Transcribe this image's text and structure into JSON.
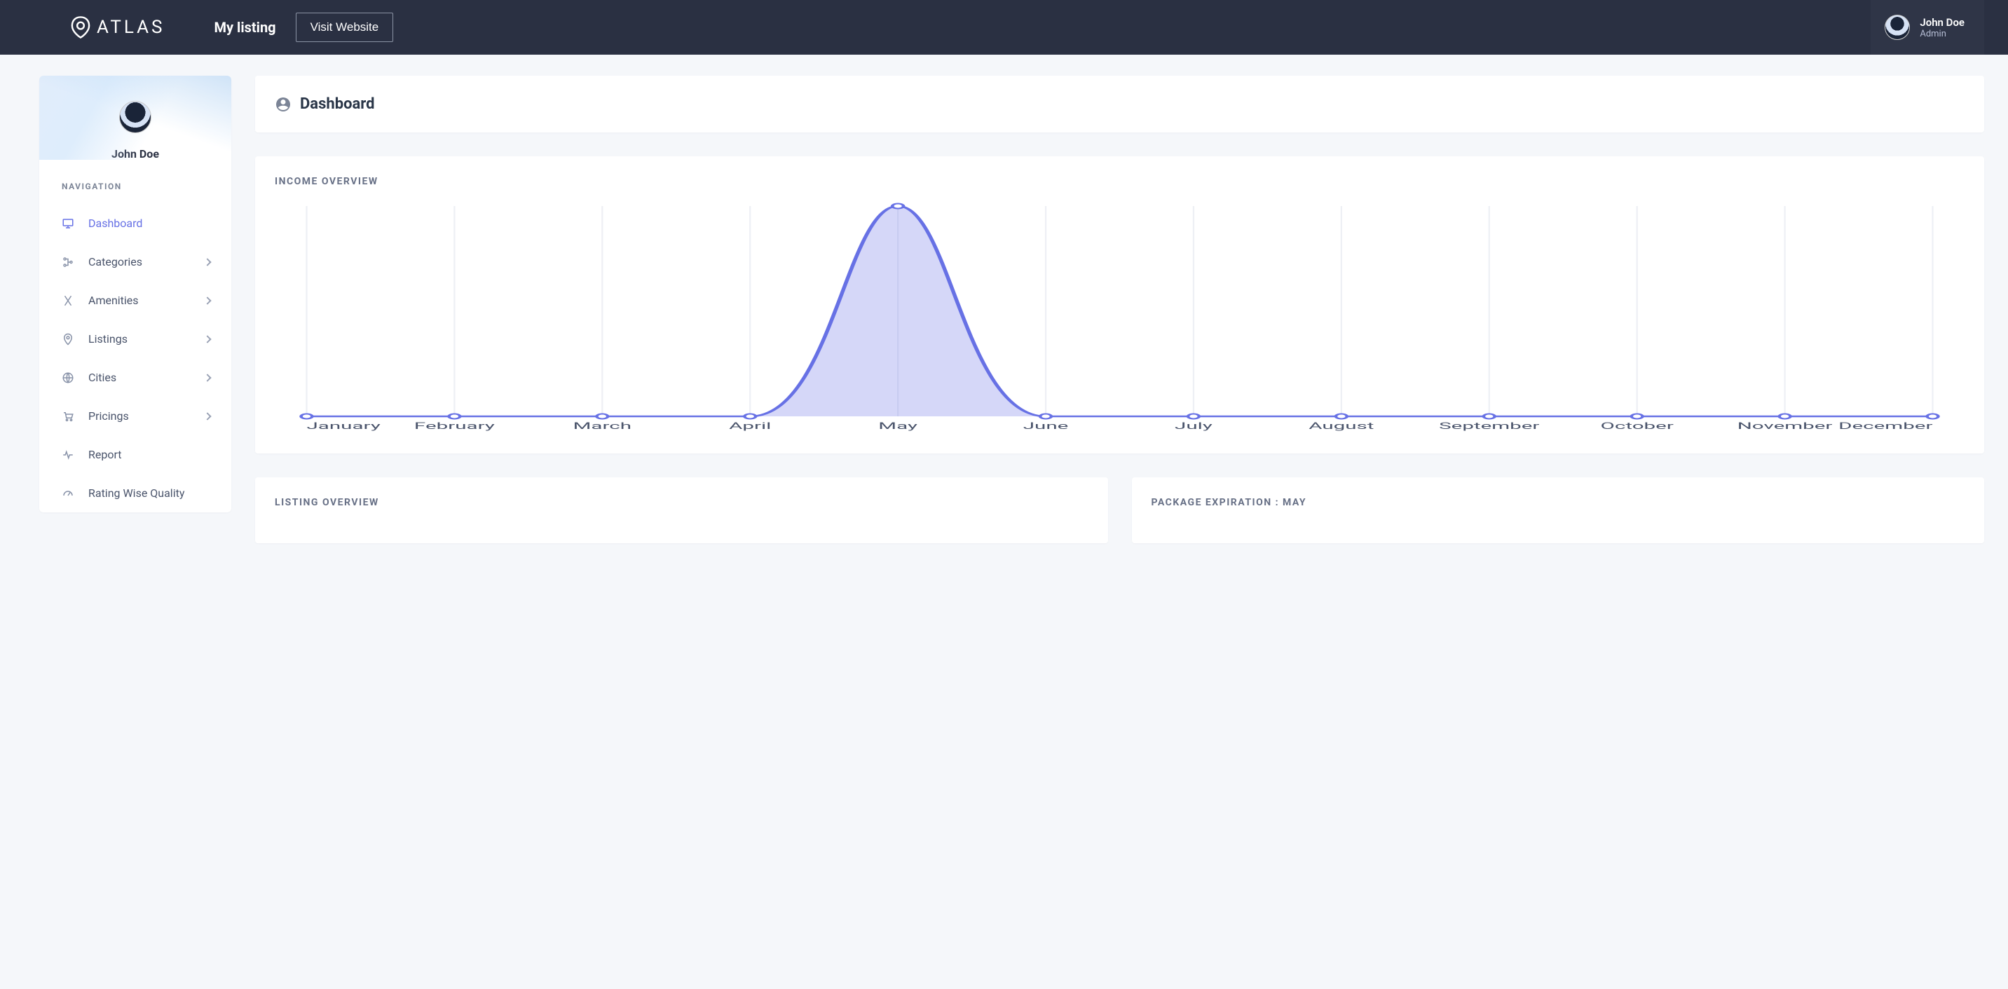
{
  "header": {
    "brand": "ATLAS",
    "my_listing": "My listing",
    "visit_website": "Visit Website",
    "user": {
      "name": "John Doe",
      "role": "Admin"
    }
  },
  "sidebar": {
    "user_name": "John Doe",
    "nav_heading": "NAVIGATION",
    "items": [
      {
        "label": "Dashboard",
        "icon": "monitor",
        "active": true,
        "expandable": false
      },
      {
        "label": "Categories",
        "icon": "tree",
        "active": false,
        "expandable": true
      },
      {
        "label": "Amenities",
        "icon": "utensils",
        "active": false,
        "expandable": true
      },
      {
        "label": "Listings",
        "icon": "pin",
        "active": false,
        "expandable": true
      },
      {
        "label": "Cities",
        "icon": "globe",
        "active": false,
        "expandable": true
      },
      {
        "label": "Pricings",
        "icon": "cart",
        "active": false,
        "expandable": true
      },
      {
        "label": "Report",
        "icon": "pulse",
        "active": false,
        "expandable": false
      },
      {
        "label": "Rating Wise Quality",
        "icon": "gauge",
        "active": false,
        "expandable": false
      }
    ]
  },
  "dashboard": {
    "title": "Dashboard",
    "income_label": "INCOME OVERVIEW",
    "listing_label": "LISTING OVERVIEW",
    "package_label": "PACKAGE EXPIRATION : MAY"
  },
  "chart_data": {
    "type": "area",
    "x": [
      "January",
      "February",
      "March",
      "April",
      "May",
      "June",
      "July",
      "August",
      "September",
      "October",
      "November",
      "December"
    ],
    "values": [
      0,
      0,
      0,
      0,
      100,
      0,
      0,
      0,
      0,
      0,
      0,
      0
    ],
    "title": "INCOME OVERVIEW",
    "ylim": [
      0,
      100
    ],
    "color": "#6771e5",
    "fill": "rgba(103,113,229,0.28)"
  }
}
